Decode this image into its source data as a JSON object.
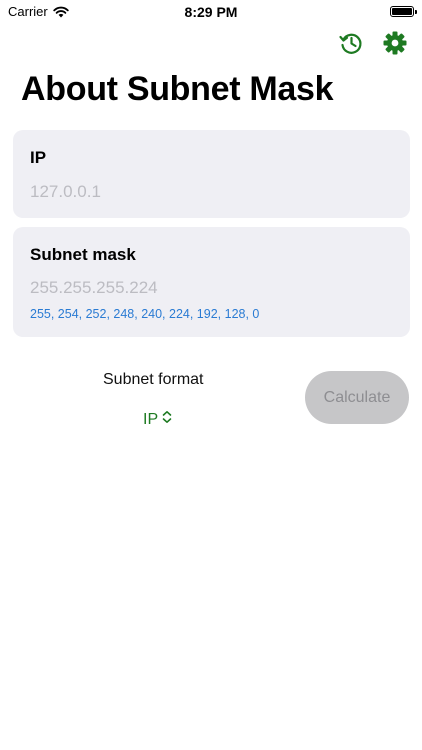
{
  "status_bar": {
    "carrier": "Carrier",
    "time": "8:29 PM"
  },
  "toolbar": {
    "history_icon": "history-icon",
    "settings_icon": "gear-icon"
  },
  "page": {
    "title": "About Subnet Mask"
  },
  "ip_field": {
    "label": "IP",
    "placeholder": "127.0.0.1"
  },
  "subnet_mask_field": {
    "label": "Subnet mask",
    "placeholder": "255.255.255.224",
    "hint": "255, 254, 252, 248, 240, 224, 192, 128, 0"
  },
  "subnet_format": {
    "label": "Subnet format",
    "selected": "IP"
  },
  "calculate_button": {
    "label": "Calculate",
    "enabled": false
  },
  "colors": {
    "accent_green": "#1e7a22",
    "hint_blue": "#2a7bd3",
    "card_bg": "#efeff4",
    "button_disabled_bg": "#c6c6c8"
  }
}
